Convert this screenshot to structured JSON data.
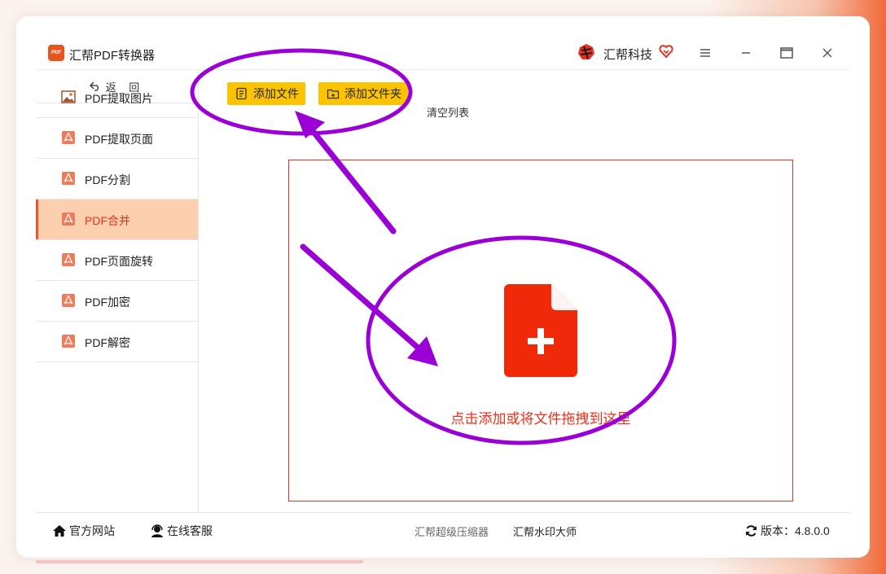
{
  "app": {
    "title": "汇帮PDF转换器",
    "logo_text": "PDF"
  },
  "brand": {
    "name": "汇帮科技"
  },
  "colors": {
    "accent": "#fcc300",
    "brand_red": "#e8301c",
    "active_bg": "#fcd0ae",
    "annotation": "#9a00d6"
  },
  "sidebar": {
    "back_label": "返 回",
    "items": [
      {
        "label": "PDF提取图片",
        "icon": "image-icon"
      },
      {
        "label": "PDF提取页面",
        "icon": "pdf-icon"
      },
      {
        "label": "PDF分割",
        "icon": "pdf-icon"
      },
      {
        "label": "PDF合并",
        "icon": "pdf-icon",
        "active": true
      },
      {
        "label": "PDF页面旋转",
        "icon": "pdf-icon"
      },
      {
        "label": "PDF加密",
        "icon": "pdf-icon"
      },
      {
        "label": "PDF解密",
        "icon": "pdf-icon"
      }
    ]
  },
  "toolbar": {
    "add_file": "添加文件",
    "add_folder": "添加文件夹",
    "clear_list": "清空列表"
  },
  "dropzone": {
    "hint": "点击添加或将文件拖拽到这里"
  },
  "footer": {
    "website": "官方网站",
    "support": "在线客服",
    "compressor": "汇帮超级压缩器",
    "watermark": "汇帮水印大师",
    "version": "版本：4.8.0.0"
  }
}
